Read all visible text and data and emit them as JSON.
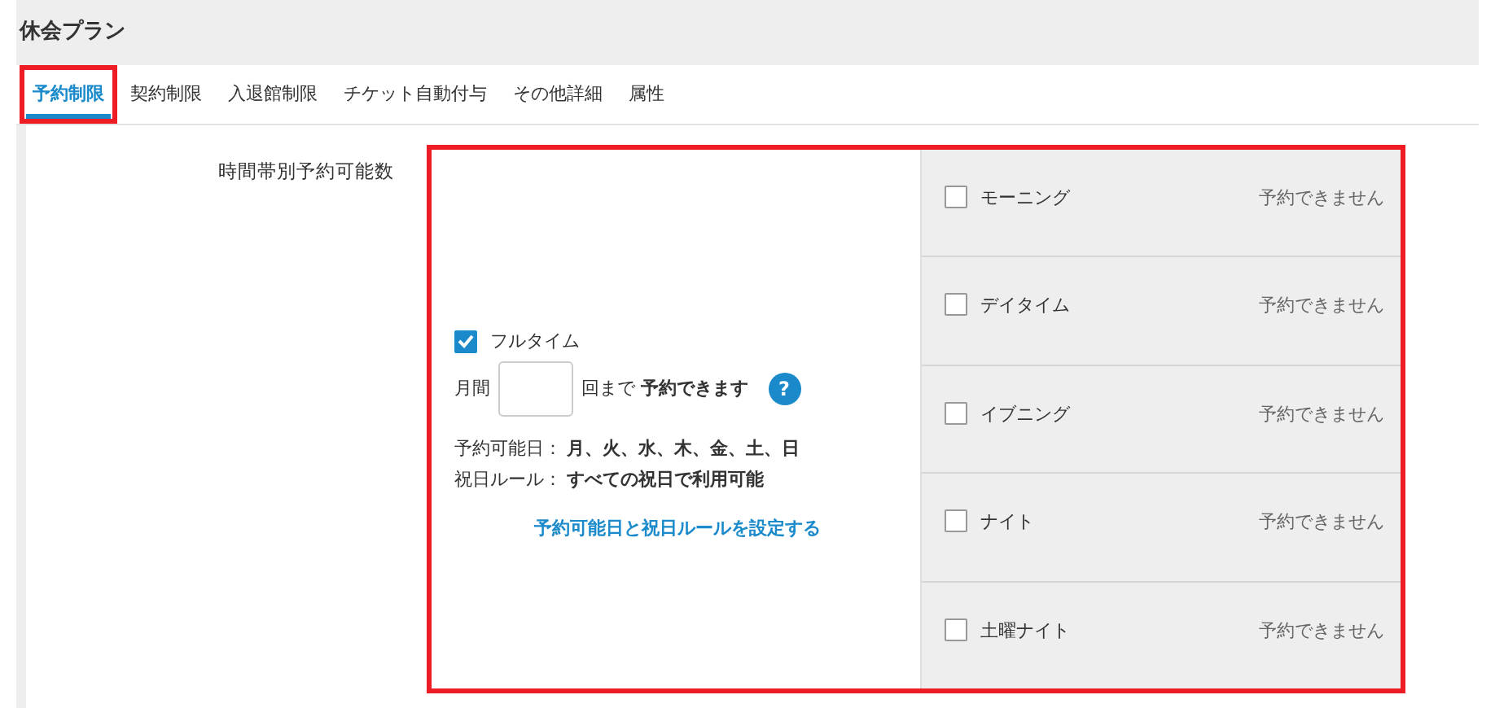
{
  "page_title": "休会プラン",
  "tabs": [
    {
      "label": "予約制限",
      "selected": true,
      "highlighted": true
    },
    {
      "label": "契約制限",
      "selected": false,
      "highlighted": false
    },
    {
      "label": "入退館制限",
      "selected": false,
      "highlighted": false
    },
    {
      "label": "チケット自動付与",
      "selected": false,
      "highlighted": false
    },
    {
      "label": "その他詳細",
      "selected": false,
      "highlighted": false
    },
    {
      "label": "属性",
      "selected": false,
      "highlighted": false
    }
  ],
  "section_label": "時間帯別予約可能数",
  "panel": {
    "highlighted": true,
    "fulltime": {
      "label": "フルタイム",
      "checked": true,
      "prefix": "月間",
      "suffix": "回まで **予約できます**",
      "help": "?",
      "days_label": "予約可能日：",
      "days_value": "月、火、水、木、金、土、日",
      "holiday_label": "祝日ルール：",
      "holiday_value": "すべての祝日で利用可能",
      "link": "予約可能日と祝日ルールを設定する"
    },
    "slots": [
      {
        "label": "モーニング",
        "checked": false,
        "status": "予約できません"
      },
      {
        "label": "デイタイム",
        "checked": false,
        "status": "予約できません"
      },
      {
        "label": "イブニング",
        "checked": false,
        "status": "予約できません"
      },
      {
        "label": "ナイト",
        "checked": false,
        "status": "予約できません"
      },
      {
        "label": "土曜ナイト",
        "checked": false,
        "status": "予約できません"
      }
    ]
  }
}
